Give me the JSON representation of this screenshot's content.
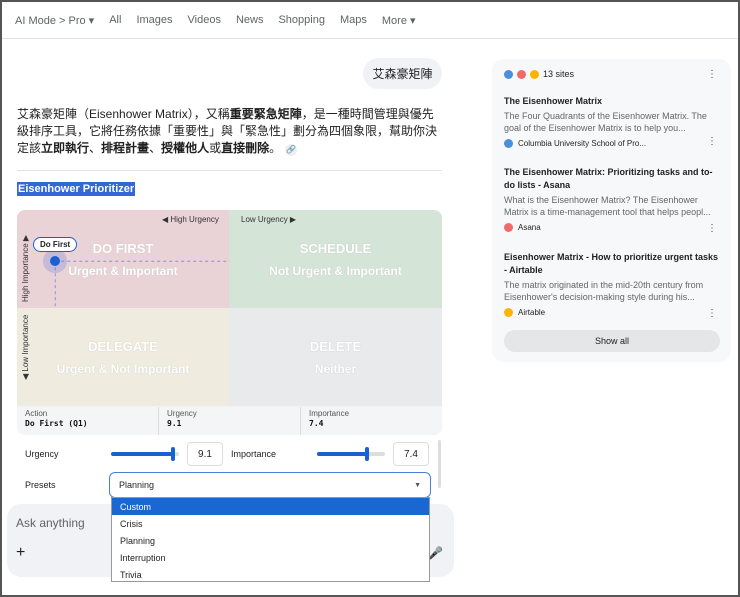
{
  "nav": {
    "items": [
      "AI Mode > Pro ▾",
      "All",
      "Images",
      "Videos",
      "News",
      "Shopping",
      "Maps",
      "More ▾"
    ]
  },
  "query": "艾森豪矩陣",
  "answer": {
    "p1": "艾森豪矩陣（Eisenhower Matrix），又稱",
    "b1": "重要緊急矩陣",
    "p2": "，是一種時間管理與優先級排序工具，它將任務依據「重要性」與「緊急性」劃分為四個象限，幫助你決定該",
    "b2": "立即執行",
    "p3": "、",
    "b3": "排程計畫",
    "p4": "、",
    "b4": "授權他人",
    "p5": "或",
    "b5": "直接刪除",
    "p6": "。",
    "cite_icon": "link-icon"
  },
  "widget": {
    "title": "Eisenhower Prioritizer",
    "high_urgency": "◀ High Urgency",
    "low_urgency": "Low Urgency ▶",
    "high_importance": "High Importance ▶",
    "low_importance": "◀ Low Importance",
    "quadrants": [
      {
        "h": "DO FIRST",
        "s": "Urgent & Important"
      },
      {
        "h": "SCHEDULE",
        "s": "Not Urgent & Important"
      },
      {
        "h": "DELEGATE",
        "s": "Urgent & Not Important"
      },
      {
        "h": "DELETE",
        "s": "Neither"
      }
    ],
    "point_label": "Do First",
    "info": {
      "action_label": "Action",
      "action": "Do First (Q1)",
      "urgency_label": "Urgency",
      "urgency": "9.1",
      "importance_label": "Importance",
      "importance": "7.4"
    },
    "controls": {
      "urgency_label": "Urgency",
      "urgency_value": "9.1",
      "urgency": 9.1,
      "importance_label": "Importance",
      "importance_value": "7.4",
      "importance": 7.4,
      "max": 10,
      "presets_label": "Presets",
      "preset": "Planning",
      "options": [
        "Custom",
        "Crisis",
        "Planning",
        "Interruption",
        "Trivia"
      ]
    },
    "accent": "#1a5fd6"
  },
  "ask": {
    "placeholder": "Ask anything",
    "plus": "+",
    "mic": "🎤"
  },
  "sources": {
    "count": "13 sites",
    "items": [
      {
        "title": "The Eisenhower Matrix",
        "desc": "The Four Quadrants of the Eisenhower Matrix. The goal of the Eisenhower Matrix is to help you...",
        "site": "Columbia University School of Pro..."
      },
      {
        "title": "The Eisenhower Matrix: Prioritizing tasks and to-do lists - Asana",
        "desc": "What is the Eisenhower Matrix? The Eisenhower Matrix is a time-management tool that helps peopl...",
        "site": "Asana"
      },
      {
        "title": "Eisenhower Matrix - How to prioritize urgent tasks - Airtable",
        "desc": "The matrix originated in the mid-20th century from Eisenhower's decision-making style during his...",
        "site": "Airtable"
      }
    ],
    "show_all": "Show all"
  }
}
